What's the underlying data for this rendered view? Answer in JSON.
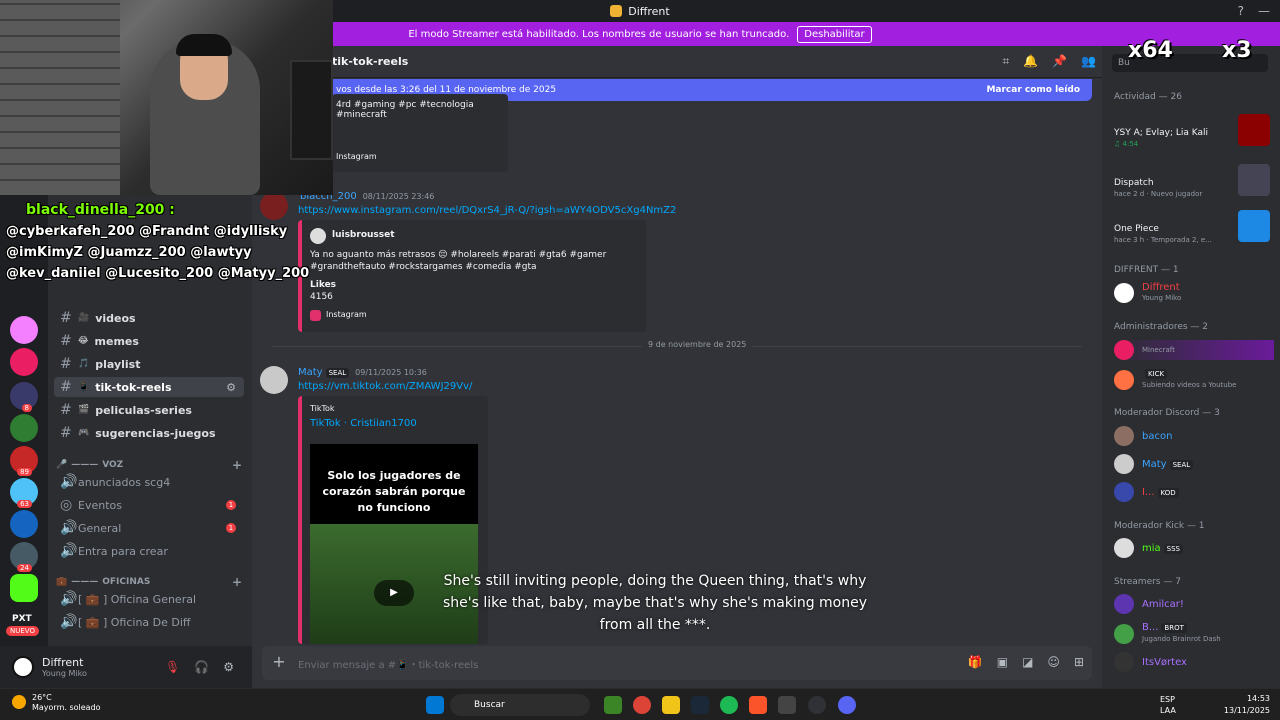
{
  "titlebar": {
    "title": "Diffrent"
  },
  "streamer_bar": {
    "text": "El modo Streamer está habilitado. Los nombres de usuario se han truncado.",
    "button": "Deshabilitar"
  },
  "overlay": {
    "mult1": "x64",
    "mult2": "x3"
  },
  "chat_overlay": [
    "black_dinella_200 :",
    "@cyberkafeh_200 @Frandnt @idyllisky",
    "@imKimyZ @Juamzz_200 @lawtyy",
    "@kev_daniiel @Lucesito_200 @Matyy_200"
  ],
  "channels": {
    "items": [
      {
        "name": "videos",
        "emoji": "🎥",
        "active": false
      },
      {
        "name": "memes",
        "emoji": "😂",
        "active": false
      },
      {
        "name": "playlist",
        "emoji": "🎵",
        "active": false
      },
      {
        "name": "tik-tok-reels",
        "emoji": "📱",
        "active": true
      },
      {
        "name": "peliculas-series",
        "emoji": "🎬",
        "active": false
      },
      {
        "name": "sugerencias-juegos",
        "emoji": "🎮",
        "active": false
      }
    ],
    "voice_category": "VOZ",
    "voice": [
      {
        "name": "anunciados scg4",
        "badge": ""
      },
      {
        "name": "Eventos",
        "badge": "1"
      },
      {
        "name": "General",
        "badge": "1"
      },
      {
        "name": "Entra para crear",
        "badge": ""
      }
    ],
    "office_category": "OFICINAS",
    "offices": [
      {
        "name": "[ 💼 ] Oficina General"
      },
      {
        "name": "[ 💼 ] Oficina De Diff"
      }
    ]
  },
  "server_badges": [
    "8",
    "89",
    "63",
    "24",
    "NUEVO"
  ],
  "server_label": "PXT",
  "user": {
    "name": "Diffrent",
    "status": "Young Miko"
  },
  "header": {
    "channel": "tik-tok-reels"
  },
  "new_bar": {
    "text": "vos desde las 3:26 del 11 de noviembre de 2025",
    "mark": "Marcar como leído"
  },
  "messages": {
    "top_tags": "4rd #gaming #pc #tecnologia #minecraft",
    "top_source": "Instagram",
    "m1": {
      "author": "blacch_200",
      "time": "08/11/2025 23:46",
      "link": "https://www.instagram.com/reel/DQxrS4_jR-Q/?igsh=aWY4ODV5cXg4NmZ2",
      "embed_author": "luisbrousset",
      "embed_text1": "Ya no aguanto más retrasos 😔 #holareels #parati #gta6 #gamer",
      "embed_text2": "#grandtheftauto #rockstargames #comedia #gta",
      "likes_label": "Likes",
      "likes": "4156",
      "source": "Instagram"
    },
    "divider": "9 de noviembre de 2025",
    "m2": {
      "author": "Maty",
      "tag": "SEAL",
      "time": "09/11/2025 10:36",
      "link": "https://vm.tiktok.com/ZMAWJ29Vv/",
      "embed_provider": "TikTok",
      "embed_title": "TikTok · Cristiian1700",
      "thumb_text": "Solo los jugadores de corazón sabrán porque no funciono"
    }
  },
  "composer": {
    "placeholder": "Enviar mensaje a #📱・tik-tok-reels"
  },
  "subtitle": "She's still inviting people, doing the Queen thing, that's why she's like that, baby, maybe that's why she's making money from all the ***.",
  "members": {
    "search": "Bu",
    "activity_header": "Actividad — 26",
    "activity": [
      {
        "name": "YSY A; Evlay; Lia Kali",
        "sub": "♫ 4:54"
      },
      {
        "name": "Dispatch",
        "sub": "hace 2 d · Nuevo jugador"
      },
      {
        "name": "One Piece",
        "sub": "hace 3 h · Temporada 2, e..."
      }
    ],
    "groups": [
      {
        "header": "DIFFRENT — 1"
      },
      {
        "header": "Administradores — 2"
      },
      {
        "header": "Moderador Discord — 3"
      },
      {
        "header": "Moderador Kick — 1"
      },
      {
        "header": "Streamers — 7"
      }
    ],
    "list": {
      "diffrent": {
        "name": "Diffrent",
        "sub": "Young Miko"
      },
      "admin1": {
        "name": "",
        "sub": "Minecraft"
      },
      "admin2": {
        "name": "",
        "tag": "KICK",
        "sub": "Subiendo videos a Youtube"
      },
      "bacon": {
        "name": "bacon"
      },
      "maty": {
        "name": "Maty",
        "tag": "SEAL"
      },
      "kod": {
        "name": "I...",
        "tag": "KOD"
      },
      "mia": {
        "name": "mia",
        "tag": "SSS"
      },
      "amilcar": {
        "name": "Amilcar!"
      },
      "brot": {
        "name": "B...",
        "tag": "BROT",
        "sub": "Jugando Brainrot Dash"
      },
      "itsvortex": {
        "name": "ItsVørtex"
      }
    }
  },
  "taskbar": {
    "weather_temp": "26°C",
    "weather_desc": "Mayorm. soleado",
    "search": "Buscar",
    "lang1": "ESP",
    "lang2": "LAA",
    "time": "14:53",
    "date": "13/11/2025"
  }
}
